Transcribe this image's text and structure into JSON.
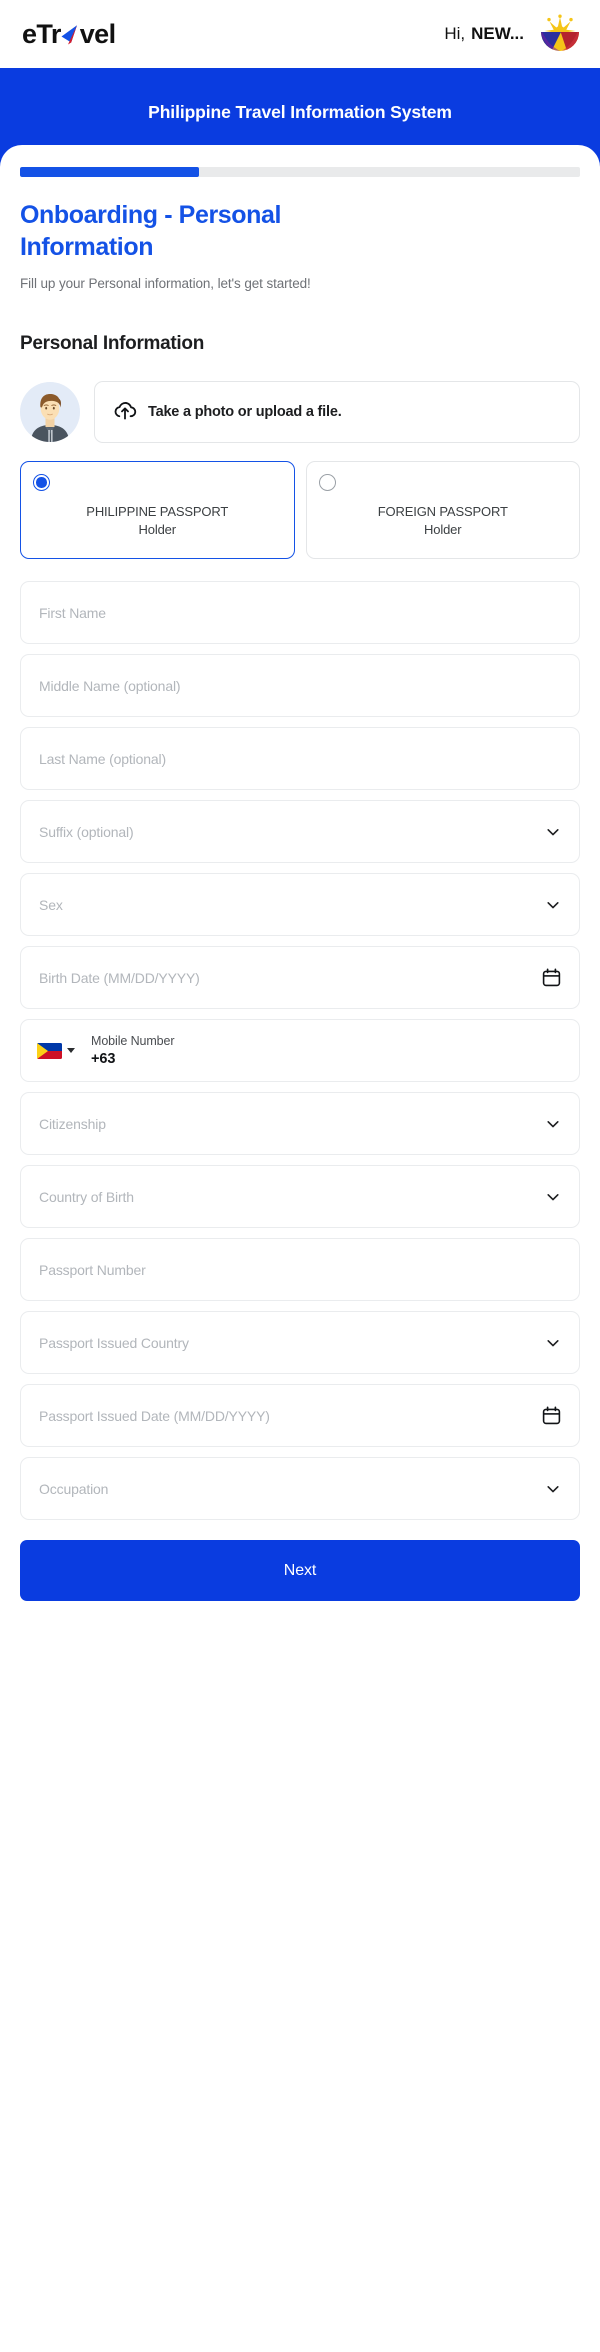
{
  "header": {
    "logo_text_1": "eTr",
    "logo_text_2": "vel",
    "greeting_prefix": "Hi,",
    "user_name": "NEW...",
    "seal_name": "philippine-government-seal"
  },
  "banner": {
    "title": "Philippine Travel Information System"
  },
  "progress": {
    "percent": 32,
    "fill_color": "#1452E6",
    "track_color": "#E9EAEB"
  },
  "page": {
    "title": "Onboarding - Personal Information",
    "subtitle": "Fill up your Personal information, let's get started!",
    "section_heading": "Personal Information"
  },
  "photo": {
    "upload_label": "Take a photo or upload a file.",
    "upload_icon": "cloud-upload-icon",
    "avatar_icon": "user-avatar-illustration"
  },
  "passport_options": [
    {
      "line1": "PHILIPPINE PASSPORT",
      "line2": "Holder",
      "selected": true
    },
    {
      "line1": "FOREIGN PASSPORT",
      "line2": "Holder",
      "selected": false
    }
  ],
  "fields": [
    {
      "name": "first-name",
      "placeholder": "First Name",
      "value": "",
      "trailing": "none"
    },
    {
      "name": "middle-name",
      "placeholder": "Middle Name (optional)",
      "value": "",
      "trailing": "none"
    },
    {
      "name": "last-name",
      "placeholder": "Last Name (optional)",
      "value": "",
      "trailing": "none"
    },
    {
      "name": "suffix",
      "placeholder": "Suffix (optional)",
      "value": "",
      "trailing": "chevron"
    },
    {
      "name": "sex",
      "placeholder": "Sex",
      "value": "",
      "trailing": "chevron"
    },
    {
      "name": "birth-date",
      "placeholder": "Birth Date (MM/DD/YYYY)",
      "value": "",
      "trailing": "calendar"
    },
    {
      "name": "citizenship",
      "placeholder": "Citizenship",
      "value": "",
      "trailing": "chevron"
    },
    {
      "name": "country-of-birth",
      "placeholder": "Country of Birth",
      "value": "",
      "trailing": "chevron"
    },
    {
      "name": "passport-number",
      "placeholder": "Passport Number",
      "value": "",
      "trailing": "none"
    },
    {
      "name": "passport-issued-country",
      "placeholder": "Passport Issued Country",
      "value": "",
      "trailing": "chevron"
    },
    {
      "name": "passport-issued-date",
      "placeholder": "Passport Issued Date (MM/DD/YYYY)",
      "value": "",
      "trailing": "calendar"
    },
    {
      "name": "occupation",
      "placeholder": "Occupation",
      "value": "",
      "trailing": "chevron"
    }
  ],
  "mobile": {
    "label": "Mobile Number",
    "country_code": "+63",
    "flag": "philippines-flag-icon"
  },
  "footer": {
    "next_label": "Next"
  },
  "colors": {
    "brand_blue": "#0A3CE0",
    "accent_blue": "#1452E6",
    "placeholder_grey": "#B2B6BB",
    "border_grey": "#EAECEE"
  }
}
